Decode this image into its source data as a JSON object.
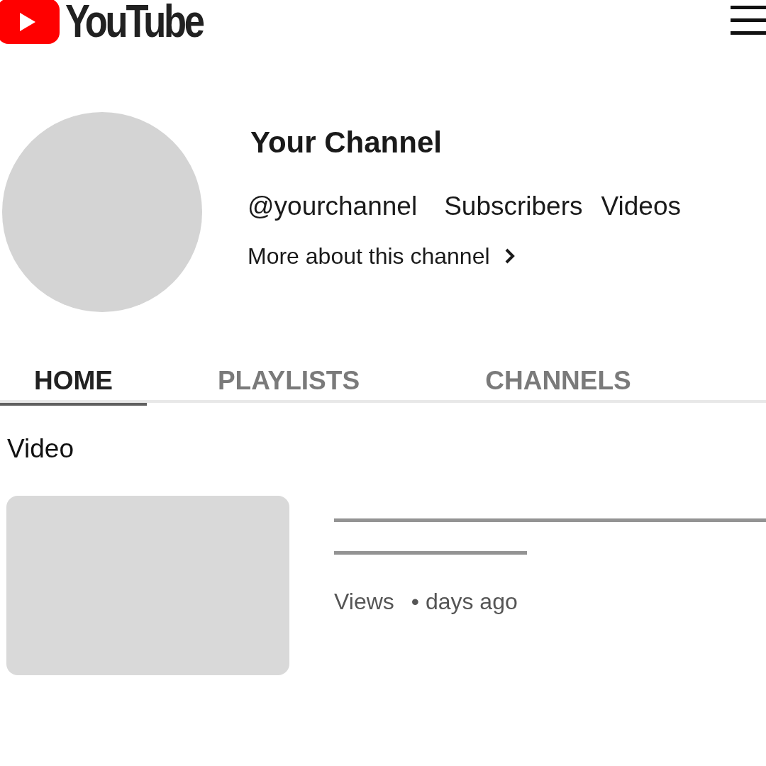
{
  "header": {
    "logo_text": "YouTube"
  },
  "channel": {
    "name": "Your Channel",
    "handle": "@yourchannel",
    "stats": [
      "Subscribers",
      "Videos"
    ],
    "more_link": "More about this channel"
  },
  "tabs": [
    {
      "label": "HOME",
      "selected": true
    },
    {
      "label": "PLAYLISTS",
      "selected": false
    },
    {
      "label": "CHANNELS",
      "selected": false
    }
  ],
  "section_title": "Video",
  "video": {
    "views": "Views",
    "age": "• days ago"
  }
}
